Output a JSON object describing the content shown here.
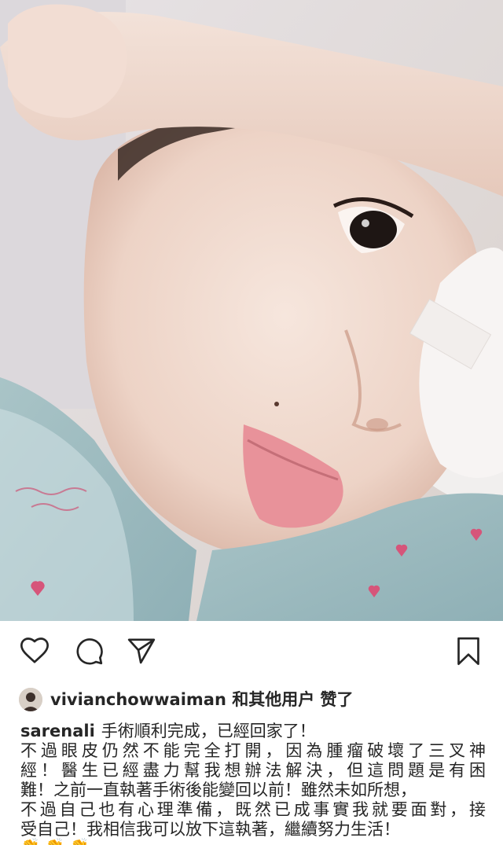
{
  "post": {
    "photo_alt": "",
    "actions": {
      "like_icon": "heart-outline-icon",
      "comment_icon": "comment-bubble-icon",
      "share_icon": "paper-plane-icon",
      "save_icon": "bookmark-icon"
    },
    "likes": {
      "user": "vivianchowwaiman",
      "rest": " 和其他用户 赞了"
    },
    "caption": {
      "author": "sarenali",
      "first_line": "手術順利完成，已經回家了！",
      "lines": [
        "不過眼皮仍然不能完全打開，因為腫瘤破壞了三叉神",
        "經！醫生已經盡力幫我想辦法解決，但這問題是有困",
        "難！之前一直執著手術後能變回以前！雖然未如所想，",
        "不過自己也有心理準備，既然已成事實我就要面對，接",
        "受自己！我相信我可以放下這執著，繼續努力生活！"
      ],
      "emoji_row": "👏 👏 👏"
    }
  }
}
